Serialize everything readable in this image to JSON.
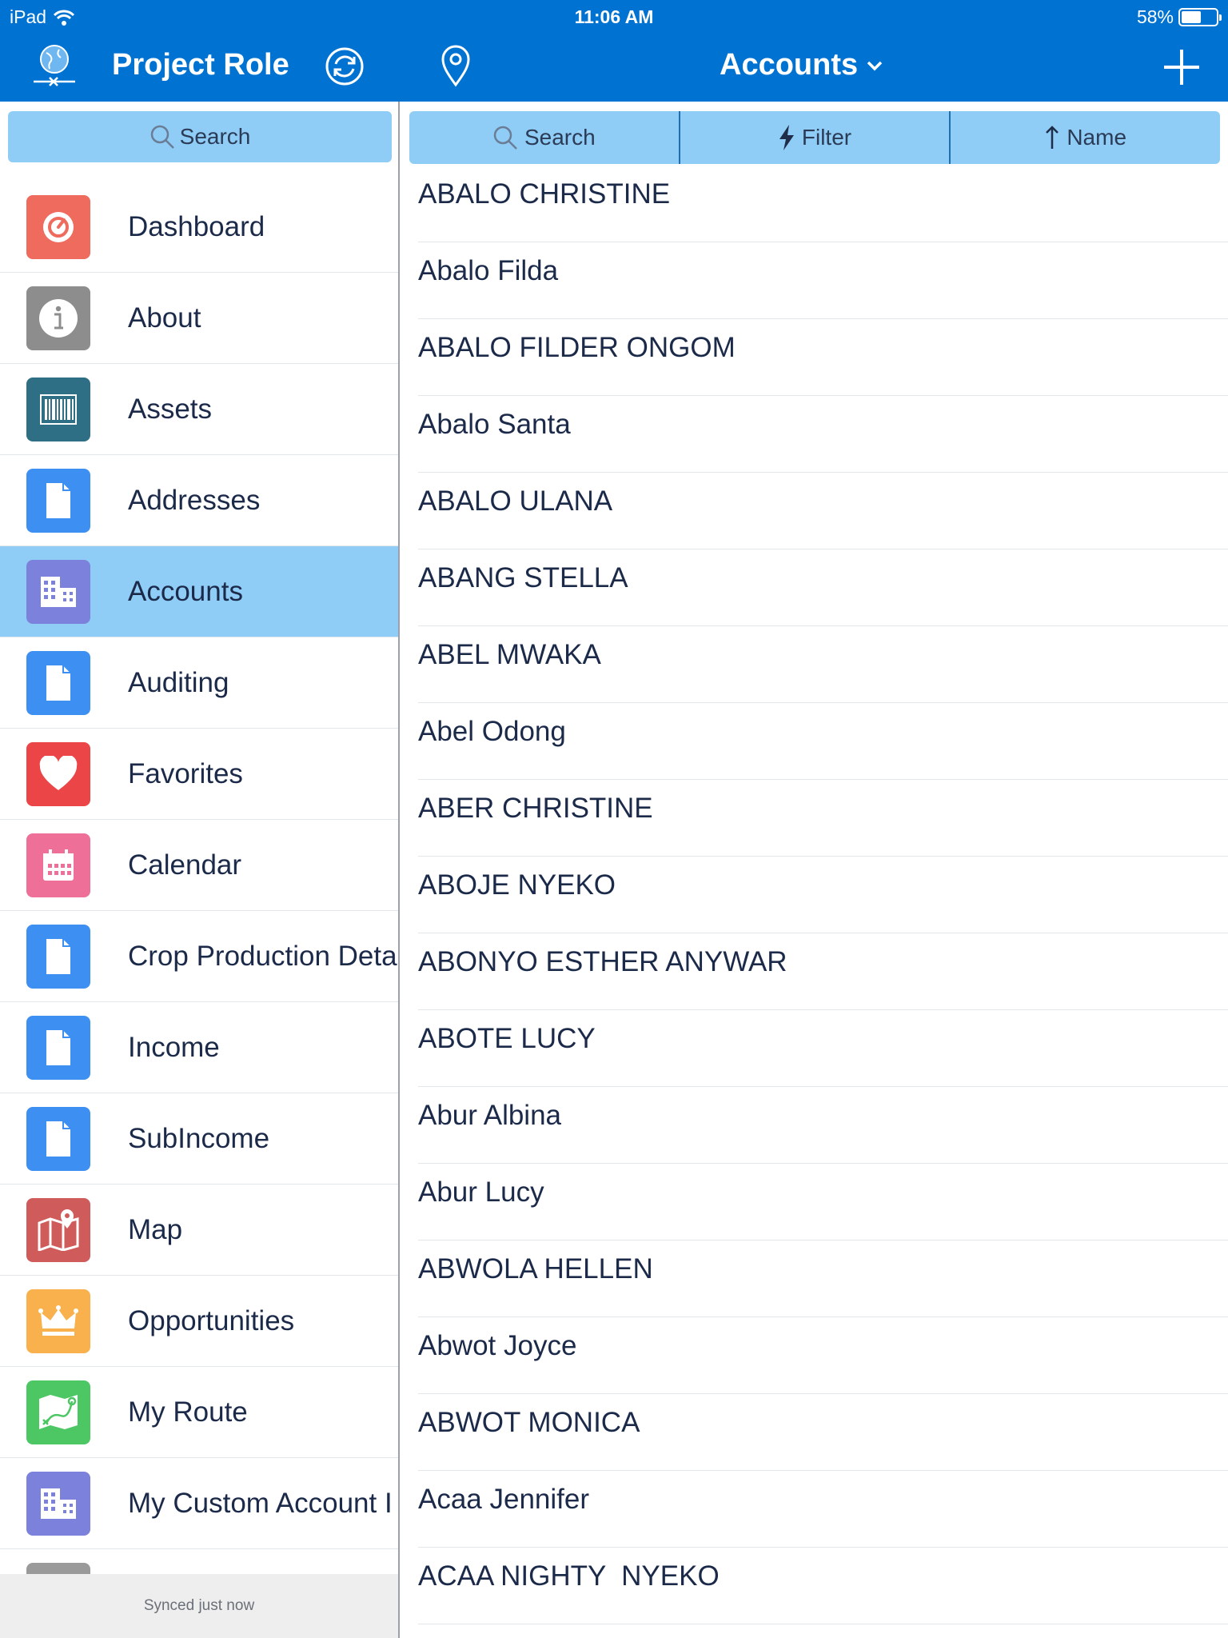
{
  "status_bar": {
    "carrier": "iPad",
    "time": "11:06 AM",
    "battery": "58%",
    "battery_level": 0.58
  },
  "header": {
    "left_title": "Project Role",
    "center_title": "Accounts",
    "icons": [
      "globe-logo-icon",
      "sync-icon",
      "location-pin-icon",
      "chevron-down-icon",
      "plus-icon"
    ]
  },
  "sidebar": {
    "search_label": "Search",
    "items": [
      {
        "label": "Dashboard",
        "icon": "gauge-icon",
        "color": "#ee6b5d",
        "active": false
      },
      {
        "label": "About",
        "icon": "info-icon",
        "color": "#8d8d8d",
        "active": false
      },
      {
        "label": "Assets",
        "icon": "barcode-icon",
        "color": "#2f6f86",
        "active": false
      },
      {
        "label": "Addresses",
        "icon": "document-icon",
        "color": "#3e8ff2",
        "active": false
      },
      {
        "label": "Accounts",
        "icon": "building-icon",
        "color": "#7c82db",
        "active": true
      },
      {
        "label": "Auditing",
        "icon": "document-icon",
        "color": "#3e8ff2",
        "active": false
      },
      {
        "label": "Favorites",
        "icon": "heart-icon",
        "color": "#ec4548",
        "active": false
      },
      {
        "label": "Calendar",
        "icon": "calendar-icon",
        "color": "#ee6f98",
        "active": false
      },
      {
        "label": "Crop Production Deta",
        "icon": "document-icon",
        "color": "#3e8ff2",
        "active": false
      },
      {
        "label": "Income",
        "icon": "document-icon",
        "color": "#3e8ff2",
        "active": false
      },
      {
        "label": "SubIncome",
        "icon": "document-icon",
        "color": "#3e8ff2",
        "active": false
      },
      {
        "label": "Map",
        "icon": "map-icon",
        "color": "#cf5b5b",
        "active": false
      },
      {
        "label": "Opportunities",
        "icon": "crown-icon",
        "color": "#f9b14e",
        "active": false
      },
      {
        "label": "My Route",
        "icon": "route-icon",
        "color": "#4cc764",
        "active": false
      },
      {
        "label": "My Custom Account I",
        "icon": "building-icon",
        "color": "#7c82db",
        "active": false
      },
      {
        "label": "",
        "icon": "gear-icon",
        "color": "#9a9a9a",
        "active": false
      }
    ],
    "footer": "Synced just now"
  },
  "toolbar": {
    "search_label": "Search",
    "filter_label": "Filter",
    "sort_label": "Name"
  },
  "accounts": [
    "ABALO CHRISTINE",
    "Abalo Filda",
    "ABALO FILDER ONGOM",
    "Abalo Santa",
    "ABALO ULANA",
    "ABANG STELLA",
    "ABEL MWAKA",
    "Abel Odong",
    "ABER CHRISTINE",
    "ABOJE NYEKO",
    "ABONYO ESTHER ANYWAR",
    "ABOTE LUCY",
    "Abur Albina",
    "Abur Lucy",
    "ABWOLA HELLEN",
    "Abwot Joyce",
    "ABWOT MONICA",
    "Acaa Jennifer",
    "ACAA NIGHTY  NYEKO"
  ]
}
